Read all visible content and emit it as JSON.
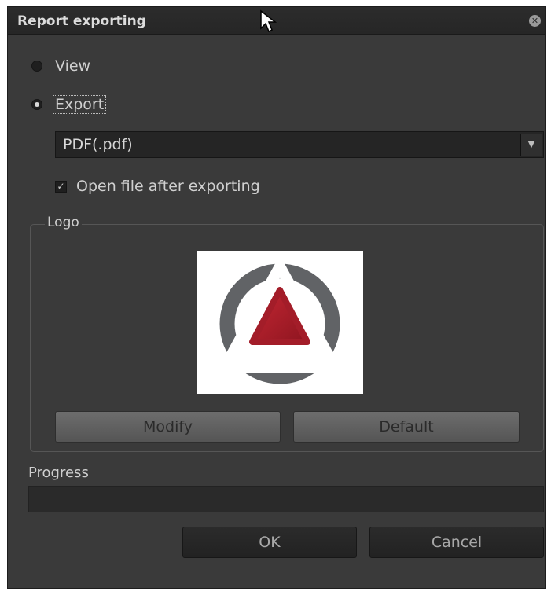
{
  "dialog": {
    "title": "Report exporting",
    "close_icon": "close-circle-icon"
  },
  "mode": {
    "view_label": "View",
    "export_label": "Export",
    "selected": "Export"
  },
  "format_select": {
    "value": "PDF(.pdf)",
    "arrow_icon": "chevron-down-icon"
  },
  "open_after_export": {
    "label": "Open file after exporting",
    "checked": true
  },
  "logo_group": {
    "legend": "Logo",
    "logo_icon": "triangle-ring-logo",
    "modify_label": "Modify",
    "default_label": "Default"
  },
  "progress": {
    "label": "Progress",
    "value": 0
  },
  "footer": {
    "ok_label": "OK",
    "cancel_label": "Cancel"
  },
  "colors": {
    "dialog_bg": "#3a3a3a",
    "logo_red": "#b3212e",
    "logo_gray": "#616366"
  }
}
